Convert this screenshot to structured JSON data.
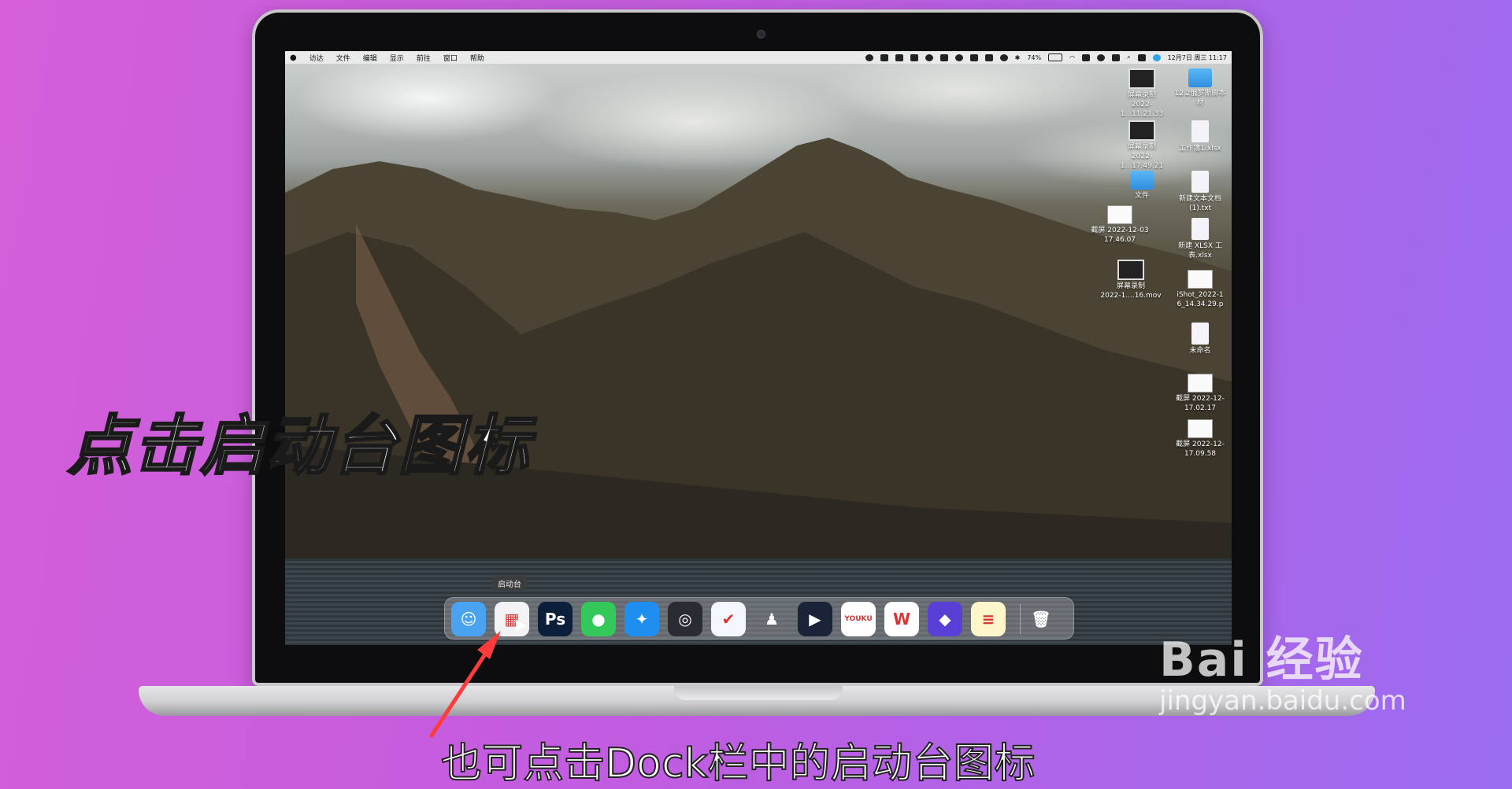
{
  "overlay": {
    "headline": "点击启动台图标",
    "subtitle": "也可点击Dock栏中的启动台图标",
    "watermark_logo": "Bai 经验",
    "watermark_url": "jingyan.baidu.com"
  },
  "menubar": {
    "items": [
      "访达",
      "文件",
      "编辑",
      "显示",
      "前往",
      "窗口",
      "帮助"
    ],
    "battery": "74%",
    "datetime": "12月7日 周三  11:17"
  },
  "desktop_icons": [
    {
      "label": "屏幕录制\n2022-1...11.21.33",
      "type": "video"
    },
    {
      "label": "12.2俄罗斯脚本\n材",
      "type": "folder"
    },
    {
      "label": "屏幕录制\n2022-1...17.49.21",
      "type": "video"
    },
    {
      "label": "工作簿1.xlsx",
      "type": "doc"
    },
    {
      "label": "文件",
      "type": "folder"
    },
    {
      "label": "新建文本文档\n(1).txt",
      "type": "doc"
    },
    {
      "label": "截屏 2022-12-03\n17.46.07",
      "type": "image"
    },
    {
      "label": "新建 XLSX 工\n表.xlsx",
      "type": "doc"
    },
    {
      "label": "屏幕录制\n2022-1....16.mov",
      "type": "video"
    },
    {
      "label": "iShot_2022-1\n6_14.34.29.p",
      "type": "image"
    },
    {
      "label": "未命名",
      "type": "doc"
    },
    {
      "label": "截屏 2022-12-\n17.02.17",
      "type": "image"
    },
    {
      "label": "截屏 2022-12-\n17.09.58",
      "type": "image"
    }
  ],
  "dock": {
    "tooltip": "启动台",
    "apps": [
      {
        "name": "finder-icon",
        "glyph": "☺",
        "bg": "#4aa3f0"
      },
      {
        "name": "launchpad-icon",
        "glyph": "▦",
        "bg": "#f3f3f6"
      },
      {
        "name": "photoshop-icon",
        "glyph": "Ps",
        "bg": "#0c1f3a"
      },
      {
        "name": "messages-icon",
        "glyph": "●",
        "bg": "#34c759"
      },
      {
        "name": "safari-icon",
        "glyph": "✦",
        "bg": "#1e8ff0"
      },
      {
        "name": "quicktime-icon",
        "glyph": "◎",
        "bg": "#2b2b33"
      },
      {
        "name": "lark-icon",
        "glyph": "✔",
        "bg": "#f5f7ff"
      },
      {
        "name": "qq-icon",
        "glyph": "♟",
        "bg": "transparent"
      },
      {
        "name": "tencent-video-icon",
        "glyph": "▶",
        "bg": "#1a2338"
      },
      {
        "name": "youku-icon",
        "glyph": "YOUKU",
        "bg": "#ffffff"
      },
      {
        "name": "wps-icon",
        "glyph": "W",
        "bg": "#ffffff"
      },
      {
        "name": "shortcuts-icon",
        "glyph": "◆",
        "bg": "#5a3fd6"
      },
      {
        "name": "notes-icon",
        "glyph": "≡",
        "bg": "#fff6cc"
      },
      {
        "name": "trash-icon",
        "glyph": "🗑",
        "bg": "transparent"
      }
    ]
  }
}
